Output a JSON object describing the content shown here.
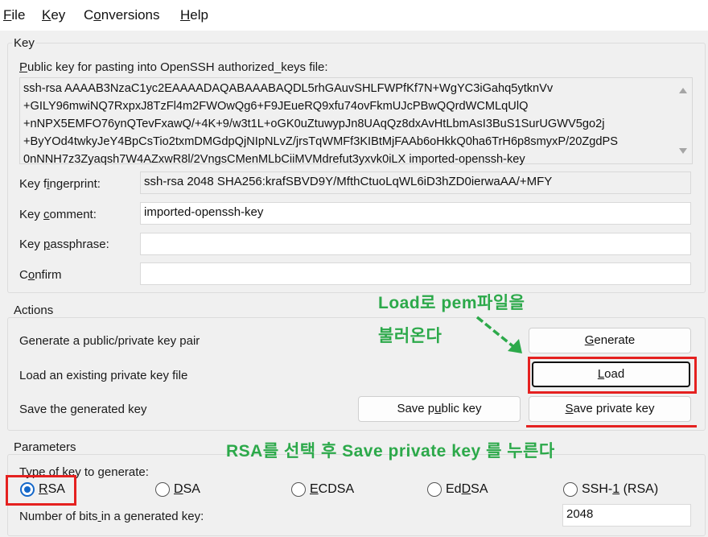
{
  "menu": [
    "File",
    "Key",
    "Conversions",
    "Help"
  ],
  "key_group": {
    "title": "Key",
    "public_key_label": "Public key for pasting into OpenSSH authorized_keys file:",
    "public_key_lines": [
      "ssh-rsa AAAAB3NzaC1yc2EAAAADAQABAAABAQDL5rhGAuvSHLFWPfKf7N+WgYC3iGahq5ytknVv",
      "+GILY96mwiNQ7RxpxJ8TzFl4m2FWOwQg6+F9JEueRQ9xfu74ovFkmUJcPBwQQrdWCMLqUlQ",
      "+nNPX5EMFO76ynQTevFxawQ/+4K+9/w3t1L+oGK0uZtuwypJn8UAqQz8dxAvHtLbmAsI3BuS1SurUGWV5go2j",
      "+ByYOd4twkyJeY4BpCsTio2txmDMGdpQjNIpNLvZ/jrsTqWMFf3KIBtMjFAAb6oHkkQ0ha6TrH6p8smyxP/20ZgdPS",
      "0nNNH7z3Zyaqsh7W4AZxwR8l/2VngsCMenMLbCiiMVMdrefut3yxvk0iLX imported-openssh-key"
    ],
    "fingerprint_label": "Key fingerprint:",
    "fingerprint_value": "ssh-rsa 2048 SHA256:krafSBVD9Y/MfthCtuoLqWL6iD3hZD0ierwaAA/+MFY",
    "comment_label": "Key comment:",
    "comment_value": "imported-openssh-key",
    "passphrase_label": "Key passphrase:",
    "passphrase_value": "",
    "confirm_label": "Confirm",
    "confirm_value": ""
  },
  "actions": {
    "title": "Actions",
    "generate_label": "Generate a public/private key pair",
    "generate_button": "Generate",
    "load_label": "Load an existing private key file",
    "load_button": "Load",
    "save_label": "Save the generated key",
    "save_public_button": "Save public key",
    "save_private_button": "Save private key"
  },
  "parameters": {
    "title": "Parameters",
    "type_label": "Type of key to generate:",
    "types": [
      {
        "label": "RSA",
        "selected": true
      },
      {
        "label": "DSA",
        "selected": false
      },
      {
        "label": "ECDSA",
        "selected": false
      },
      {
        "label": "EdDSA",
        "selected": false
      },
      {
        "label": "SSH-1 (RSA)",
        "selected": false
      }
    ],
    "bits_label": "Number of bits in a generated key:",
    "bits_value": "2048"
  },
  "annotations": {
    "load_line1": "Load로 pem파일을",
    "load_line2": "불러온다",
    "save_note": "RSA를 선택 후 Save private key 를 누른다",
    "color": "#2ca94a",
    "highlight_color": "#e52120"
  }
}
